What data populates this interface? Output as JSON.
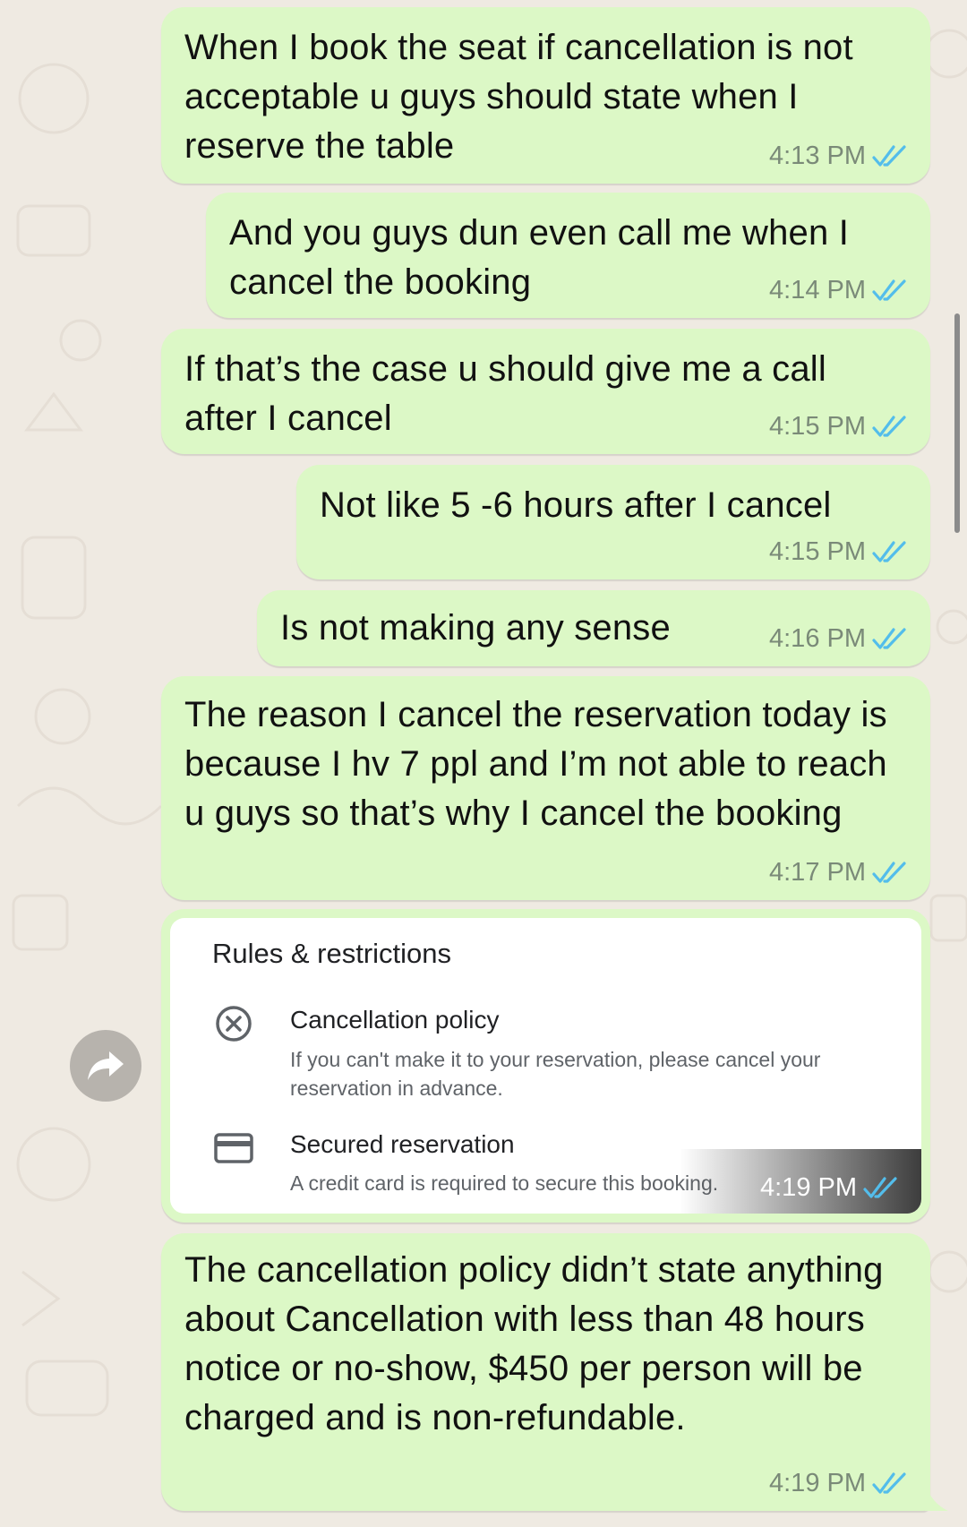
{
  "messages": [
    {
      "text": "When I book the seat if cancellation is not acceptable u guys should state when I reserve the table",
      "time": "4:13 PM"
    },
    {
      "text": "And you guys dun even call me when I cancel the booking",
      "time": "4:14 PM"
    },
    {
      "text": "If that’s the case u should give me a call after I cancel",
      "time": "4:15 PM"
    },
    {
      "text": "Not like 5 -6 hours after I cancel",
      "time": "4:15 PM"
    },
    {
      "text": "Is not making any sense",
      "time": "4:16 PM"
    },
    {
      "text": "The reason I cancel the reservation today is because I hv 7 ppl and I’m not able to reach u guys so that’s why I cancel the booking",
      "time": "4:17 PM"
    },
    {
      "text": "The cancellation policy didn’t state anything about Cancellation with less than 48 hours notice or no-show, $450 per person will be charged and is non-refundable.",
      "time": "4:19 PM"
    }
  ],
  "image_message": {
    "title": "Rules & restrictions",
    "rules": [
      {
        "icon": "cancel-circle-icon",
        "title": "Cancellation policy",
        "description": "If you can't make it to your reservation, please cancel your reservation in advance."
      },
      {
        "icon": "credit-card-icon",
        "title": "Secured reservation",
        "description": "A credit card is required to secure this booking."
      }
    ],
    "time": "4:19 PM"
  },
  "colors": {
    "bubble": "#dcf8c6",
    "background": "#efeae2",
    "read_ticks": "#53bdeb"
  }
}
